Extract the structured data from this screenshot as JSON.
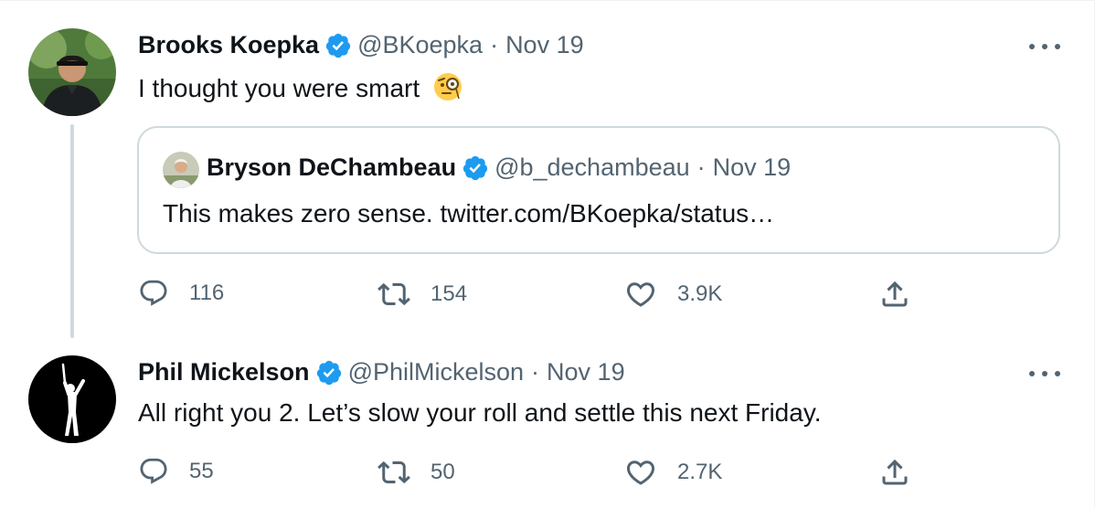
{
  "tweets": [
    {
      "name": "Brooks Koepka",
      "handle": "@BKoepka",
      "date": "Nov 19",
      "text": "I thought you were smart",
      "emoji": "face-with-monocle",
      "quote": {
        "name": "Bryson DeChambeau",
        "handle": "@b_dechambeau",
        "date": "Nov 19",
        "text": "This makes zero sense. twitter.com/BKoepka/status…"
      },
      "stats": {
        "replies": "116",
        "retweets": "154",
        "likes": "3.9K"
      }
    },
    {
      "name": "Phil Mickelson",
      "handle": "@PhilMickelson",
      "date": "Nov 19",
      "text": "All right you 2. Let’s slow your roll and settle this next Friday.",
      "stats": {
        "replies": "55",
        "retweets": "50",
        "likes": "2.7K"
      }
    }
  ],
  "separator": "·",
  "colors": {
    "verified": "#1d9bf0",
    "secondary": "#536471",
    "text": "#0f1419",
    "border": "#cfd9de"
  },
  "icons": [
    "verified-badge-icon",
    "more-icon",
    "reply-icon",
    "retweet-icon",
    "like-icon",
    "share-icon"
  ]
}
